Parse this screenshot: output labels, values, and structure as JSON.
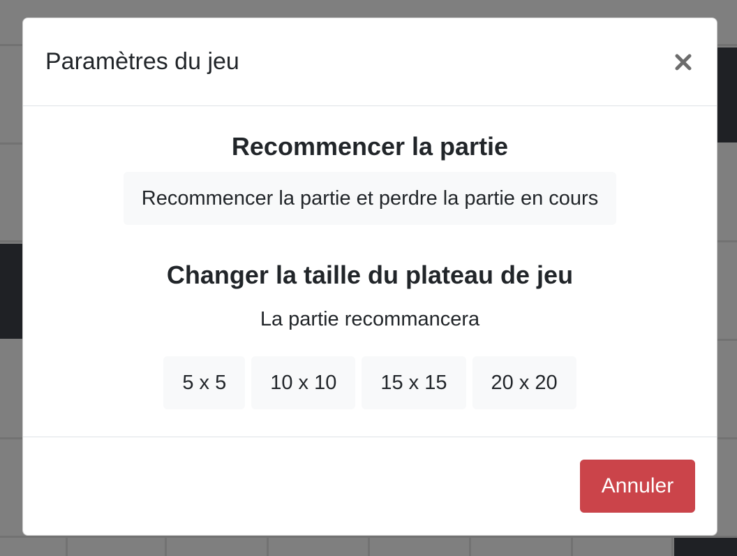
{
  "modal": {
    "title": "Paramètres du jeu",
    "close_icon": "close-icon"
  },
  "restart": {
    "heading": "Recommencer la partie",
    "button_label": "Recommencer la partie et perdre la partie en cours"
  },
  "board_size": {
    "heading": "Changer la taille du plateau de jeu",
    "note": "La partie recommancera",
    "options": [
      "5 x 5",
      "10 x 10",
      "15 x 15",
      "20 x 20"
    ]
  },
  "footer": {
    "cancel_label": "Annuler"
  },
  "colors": {
    "cancel_bg": "#cb444a",
    "button_bg": "#f8f9fa",
    "backdrop": "#7f7f7f",
    "dark_cell": "#1f2125"
  }
}
